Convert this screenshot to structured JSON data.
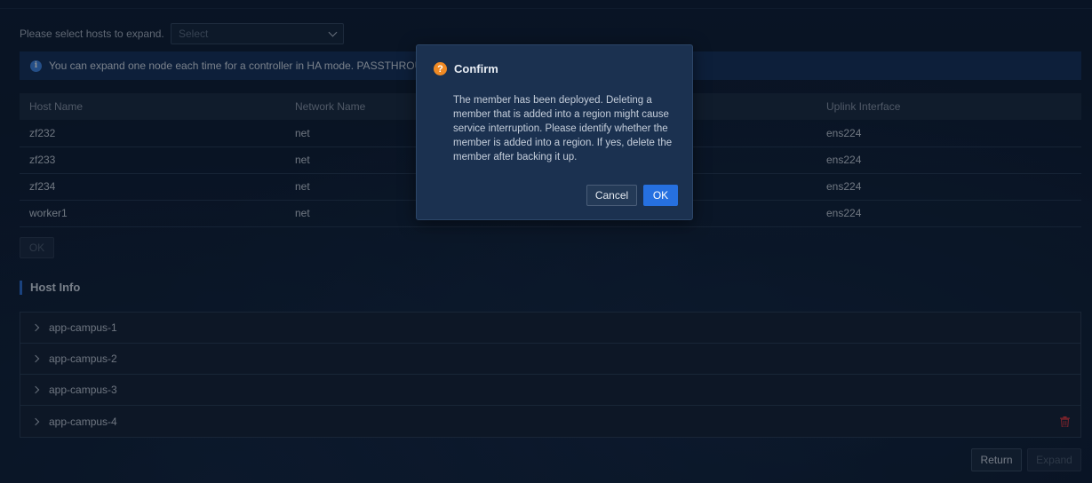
{
  "hosts_select": {
    "label": "Please select hosts to expand.",
    "placeholder": "Select"
  },
  "info_bar": {
    "text": "You can expand one node each time for a controller in HA mode. PASSTHROUGH mode"
  },
  "hosts_table": {
    "columns": [
      "Host Name",
      "Network Name",
      "",
      "Uplink Interface"
    ],
    "rows": [
      [
        "zf232",
        "net",
        "",
        "ens224"
      ],
      [
        "zf233",
        "net",
        "",
        "ens224"
      ],
      [
        "zf234",
        "net",
        "",
        "ens224"
      ],
      [
        "worker1",
        "net",
        "",
        "ens224"
      ]
    ]
  },
  "ok_button": "OK",
  "host_info": {
    "title": "Host Info",
    "items": [
      "app-campus-1",
      "app-campus-2",
      "app-campus-3",
      "app-campus-4"
    ]
  },
  "footer": {
    "return_label": "Return",
    "expand_label": "Expand"
  },
  "confirm_dialog": {
    "title": "Confirm",
    "message": "The member has been deployed. Deleting a member that is added into a region might cause service interruption. Please identify whether the member is added into a region. If yes, delete the member after backing it up.",
    "cancel_label": "Cancel",
    "ok_label": "OK"
  },
  "colors": {
    "background": "#0c1a2e",
    "accent": "#2670e0",
    "warning": "#f08a24",
    "danger": "#d9363e"
  },
  "icons": [
    "info-icon",
    "chevron-down-icon",
    "chevron-right-icon",
    "trash-icon",
    "question-icon"
  ]
}
